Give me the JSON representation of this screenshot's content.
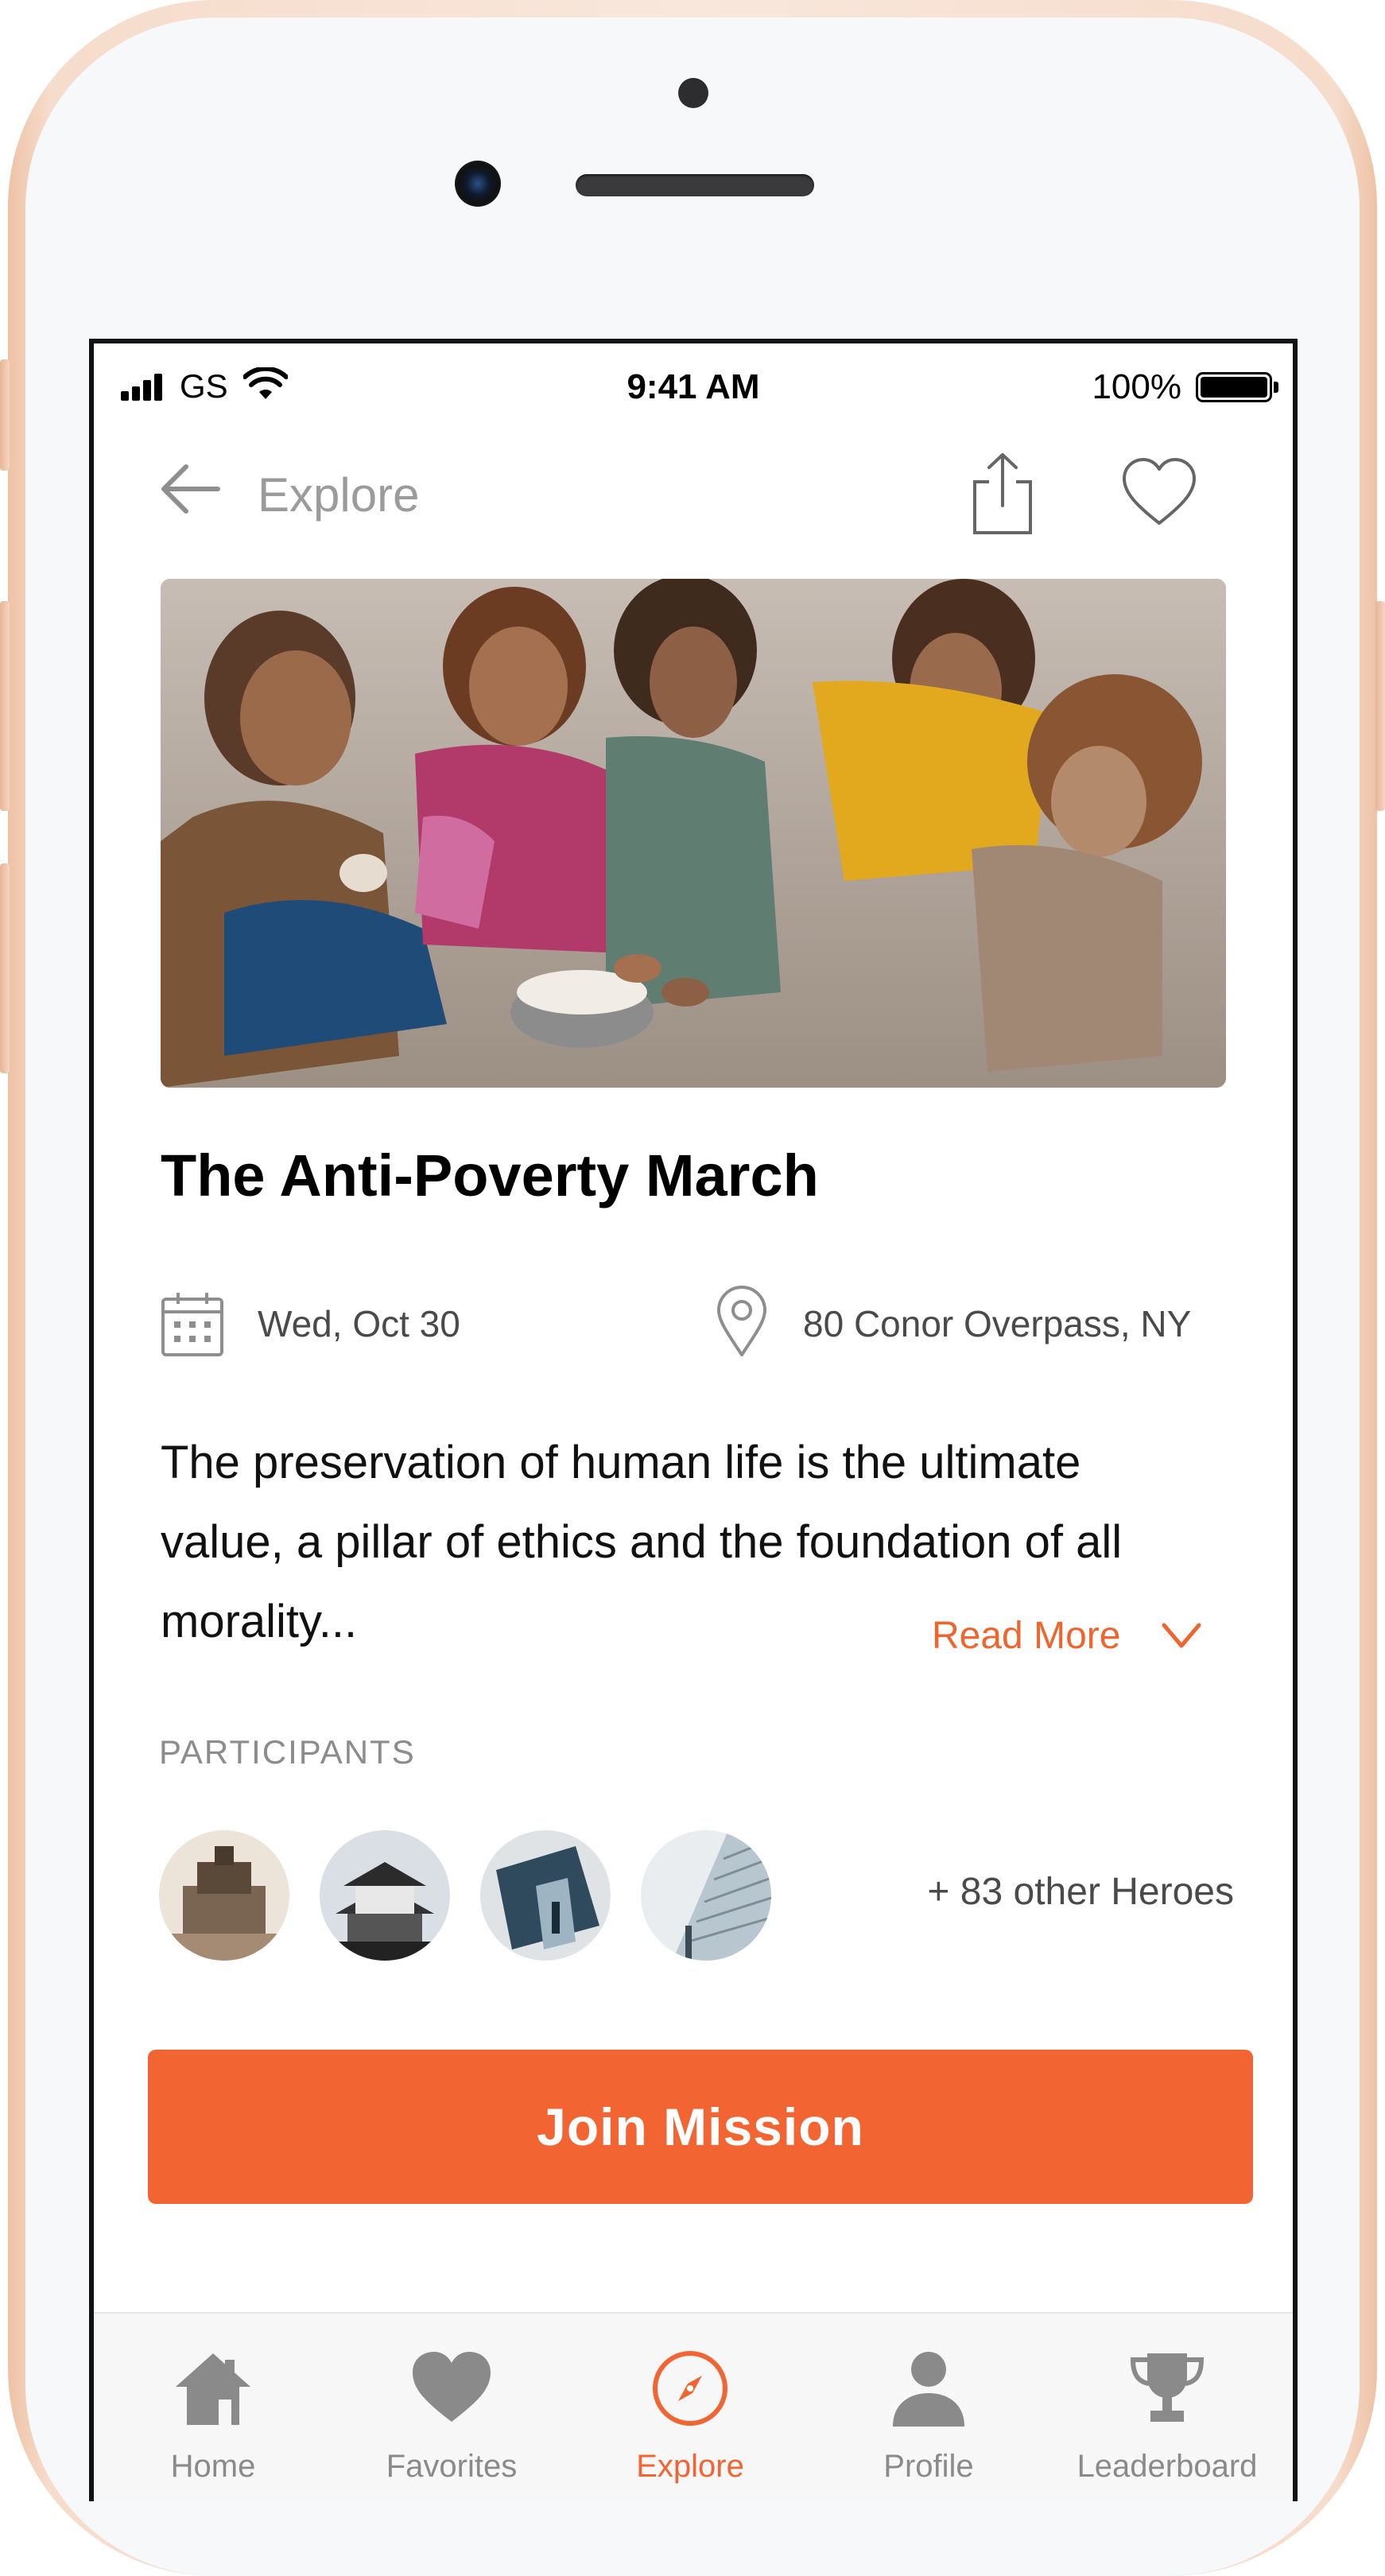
{
  "status_bar": {
    "carrier": "GS",
    "time": "9:41 AM",
    "battery": "100%"
  },
  "nav": {
    "title": "Explore",
    "icons": {
      "back": "arrow-left-icon",
      "share": "share-icon",
      "favorite": "heart-outline-icon"
    }
  },
  "mission": {
    "title": "The Anti-Poverty March",
    "date": "Wed, Oct 30",
    "location": "80 Conor Overpass, NY",
    "description": "The preservation of human life is the ultimate value, a pillar of ethics and the foundation of all morality...",
    "read_more": "Read More"
  },
  "participants": {
    "label": "PARTICIPANTS",
    "others": "+ 83 other Heroes",
    "avatars": [
      "temple-photo",
      "pagoda-photo",
      "building-photo",
      "tower-photo"
    ]
  },
  "actions": {
    "join": "Join Mission"
  },
  "tabs": [
    {
      "label": "Home",
      "icon": "home-icon",
      "active": false
    },
    {
      "label": "Favorites",
      "icon": "heart-icon",
      "active": false
    },
    {
      "label": "Explore",
      "icon": "compass-icon",
      "active": true
    },
    {
      "label": "Profile",
      "icon": "person-icon",
      "active": false
    },
    {
      "label": "Leaderboard",
      "icon": "trophy-icon",
      "active": false
    }
  ],
  "colors": {
    "accent": "#f26432",
    "text_primary": "#111111",
    "text_secondary": "#4a4a4a",
    "text_muted": "#9b9b9b",
    "frame": "#f6dccb"
  }
}
